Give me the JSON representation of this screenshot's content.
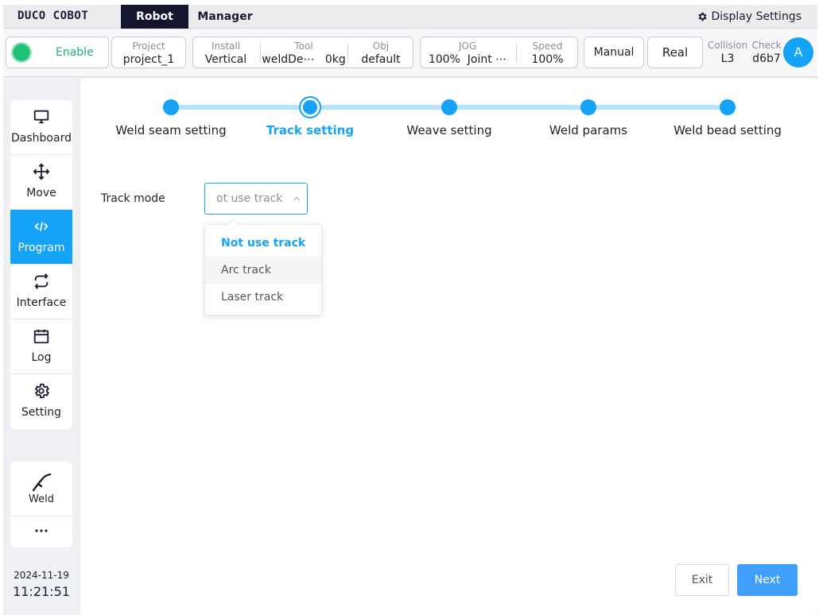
{
  "app": {
    "logo": "DUCO COBOT",
    "tabs": [
      "Robot",
      "Manager"
    ],
    "display_settings": "Display Settings"
  },
  "status": {
    "enable": "Enable",
    "project": {
      "caption": "Project",
      "value": "project_1"
    },
    "install": {
      "caption": "Install",
      "value": "Vertical"
    },
    "tool": {
      "caption": "Tool",
      "value": "weldDe⋯",
      "extra": "0kg"
    },
    "obj": {
      "caption": "Obj",
      "value": "default"
    },
    "jog": {
      "caption": "JOG",
      "value": "100%",
      "extra": "Joint ⋯"
    },
    "speed": {
      "caption": "Speed",
      "value": "100%"
    },
    "manual": "Manual",
    "real": "Real",
    "collision": {
      "caption": "Collision",
      "value": "L3"
    },
    "check": {
      "caption": "Check",
      "value": "d6b7"
    },
    "avatar": "A",
    "accent": "#14a3f7",
    "enable_color": "#20c075"
  },
  "sidebar": {
    "items": [
      {
        "label": "Dashboard",
        "icon": "monitor-icon"
      },
      {
        "label": "Move",
        "icon": "move-arrows-icon"
      },
      {
        "label": "Program",
        "icon": "code-icon",
        "active": true
      },
      {
        "label": "Interface",
        "icon": "swap-arrows-icon"
      },
      {
        "label": "Log",
        "icon": "calendar-icon"
      },
      {
        "label": "Setting",
        "icon": "gear-icon"
      }
    ],
    "weld": {
      "label": "Weld",
      "icon": "weld-torch-icon"
    },
    "more_icon": "more-dots-icon",
    "date": "2024-11-19",
    "time": "11:21:51"
  },
  "wizard": {
    "steps": [
      "Weld seam setting",
      "Track setting",
      "Weave setting",
      "Weld params",
      "Weld bead setting"
    ],
    "current_step": 1,
    "track_mode": {
      "label": "Track mode",
      "value": "ot use track",
      "options": [
        "Not use track",
        "Arc track",
        "Laser track"
      ]
    },
    "exit": "Exit",
    "next": "Next"
  }
}
